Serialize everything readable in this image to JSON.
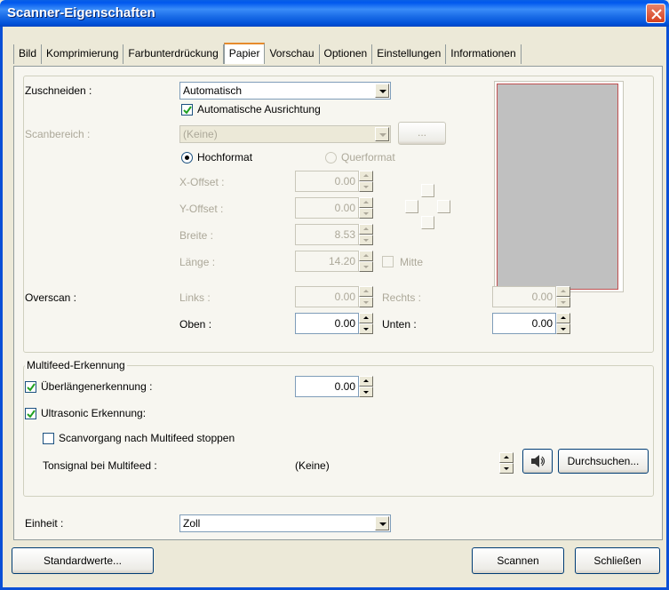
{
  "window": {
    "title": "Scanner-Eigenschaften"
  },
  "tabs": [
    {
      "label": "Bild"
    },
    {
      "label": "Komprimierung"
    },
    {
      "label": "Farbunterdrückung"
    },
    {
      "label": "Papier"
    },
    {
      "label": "Vorschau"
    },
    {
      "label": "Optionen"
    },
    {
      "label": "Einstellungen"
    },
    {
      "label": "Informationen"
    }
  ],
  "paper": {
    "crop_label": "Zuschneiden :",
    "crop_value": "Automatisch",
    "auto_align_label": "Automatische Ausrichtung",
    "scan_area_label": "Scanbereich :",
    "scan_area_value": "(Keine)",
    "scan_area_button": "...",
    "portrait_label": "Hochformat",
    "landscape_label": "Querformat",
    "x_offset_label": "X-Offset :",
    "x_offset_value": "0.00",
    "y_offset_label": "Y-Offset :",
    "y_offset_value": "0.00",
    "width_label": "Breite :",
    "width_value": "8.53",
    "length_label": "Länge :",
    "length_value": "14.20",
    "center_label": "Mitte",
    "overscan_label": "Overscan :",
    "left_label": "Links :",
    "left_value": "0.00",
    "right_label": "Rechts :",
    "right_value": "0.00",
    "top_label": "Oben :",
    "top_value": "0.00",
    "bottom_label": "Unten :",
    "bottom_value": "0.00"
  },
  "multifeed": {
    "group_title": "Multifeed-Erkennung",
    "overlength_label": "Überlängenerkennung :",
    "overlength_value": "0.00",
    "ultrasonic_label": "Ultrasonic Erkennung:",
    "stop_label": "Scanvorgang nach Multifeed stoppen",
    "tone_label": "Tonsignal bei Multifeed :",
    "tone_value": "(Keine)",
    "browse_label": "Durchsuchen..."
  },
  "unit": {
    "label": "Einheit :",
    "value": "Zoll"
  },
  "footer": {
    "defaults_label": "Standardwerte...",
    "scan_label": "Scannen",
    "close_label": "Schließen"
  }
}
